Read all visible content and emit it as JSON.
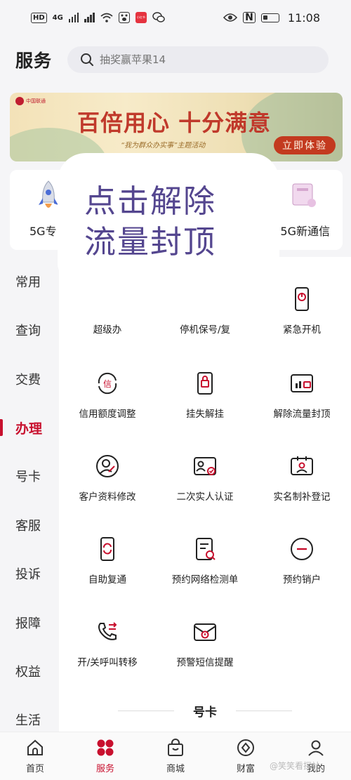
{
  "status_bar": {
    "network_label": "HD",
    "network_type": "4G",
    "time": "11:08",
    "nfc_label": "N",
    "app_badge": "小红书"
  },
  "header": {
    "title": "服务",
    "search_placeholder": "抽奖赢苹果14"
  },
  "banner": {
    "title": "百倍用心 十分满意",
    "subtitle": "“我为群众办实事”主题活动",
    "cta": "立即体验",
    "logo_text": "中国联通"
  },
  "features": [
    {
      "label": "5G专",
      "icon": "rocket-icon"
    },
    {
      "label": "5G新通信",
      "icon": "card-icon"
    }
  ],
  "overlay": {
    "line1": "点击解除",
    "line2": "流量封顶"
  },
  "categories": [
    {
      "label": "常用"
    },
    {
      "label": "查询"
    },
    {
      "label": "交费"
    },
    {
      "label": "办理",
      "active": true
    },
    {
      "label": "号卡"
    },
    {
      "label": "客服"
    },
    {
      "label": "投诉"
    },
    {
      "label": "报障"
    },
    {
      "label": "权益"
    },
    {
      "label": "生活"
    }
  ],
  "services": [
    {
      "label": "超级办",
      "icon": "super-handle-icon"
    },
    {
      "label": "停机保号/复",
      "icon": "suspend-icon"
    },
    {
      "label": "紧急开机",
      "icon": "emergency-power-icon"
    },
    {
      "label": "信用额度调整",
      "icon": "credit-adjust-icon"
    },
    {
      "label": "挂失解挂",
      "icon": "report-loss-icon"
    },
    {
      "label": "解除流量封顶",
      "icon": "unlock-data-cap-icon"
    },
    {
      "label": "客户资料修改",
      "icon": "edit-profile-icon"
    },
    {
      "label": "二次实人认证",
      "icon": "id-verify-icon"
    },
    {
      "label": "实名制补登记",
      "icon": "realname-register-icon"
    },
    {
      "label": "自助复通",
      "icon": "self-restore-icon"
    },
    {
      "label": "预约网络检测单",
      "icon": "network-check-icon"
    },
    {
      "label": "预约销户",
      "icon": "cancel-account-icon"
    },
    {
      "label": "开/关呼叫转移",
      "icon": "call-forward-icon"
    },
    {
      "label": "预警短信提醒",
      "icon": "sms-alert-icon"
    }
  ],
  "section_title": "号卡",
  "tabs": [
    {
      "label": "首页",
      "icon": "home-icon"
    },
    {
      "label": "服务",
      "icon": "service-icon",
      "active": true
    },
    {
      "label": "商城",
      "icon": "shop-icon"
    },
    {
      "label": "财富",
      "icon": "wealth-icon"
    },
    {
      "label": "我的",
      "icon": "profile-icon"
    }
  ],
  "watermark": "@笑笑看探社",
  "colors": {
    "brand_red": "#c8102e",
    "overlay_text": "#54468f",
    "banner_cta": "#c33a1f"
  }
}
